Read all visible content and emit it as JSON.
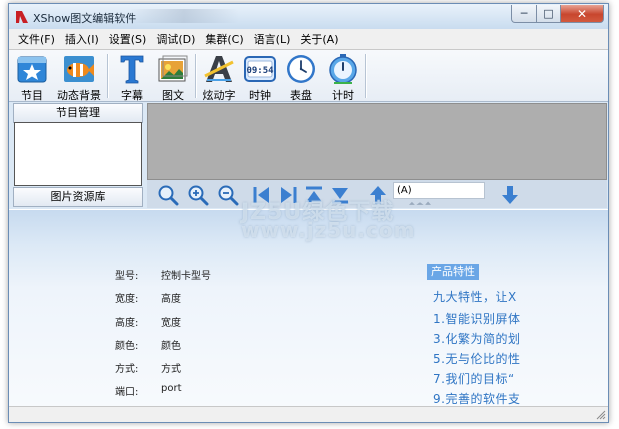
{
  "window": {
    "title": "XShow图文编辑软件",
    "buttons": {
      "minimize": "─",
      "maximize": "□",
      "close": "✕"
    }
  },
  "menu": [
    {
      "label": "文件(F)"
    },
    {
      "label": "插入(I)"
    },
    {
      "label": "设置(S)"
    },
    {
      "label": "调试(D)"
    },
    {
      "label": "集群(C)"
    },
    {
      "label": "语言(L)"
    },
    {
      "label": "关于(A)"
    }
  ],
  "toolbar": [
    {
      "label": "节目",
      "icon": "program-star-icon"
    },
    {
      "label": "动态背景",
      "icon": "clownfish-background-icon"
    },
    {
      "label": "字幕",
      "icon": "text-t-icon"
    },
    {
      "label": "图文",
      "icon": "picture-text-icon"
    },
    {
      "label": "炫动字",
      "icon": "dazzle-text-icon"
    },
    {
      "label": "时钟",
      "icon": "digital-clock-icon",
      "clock_display": "09:54"
    },
    {
      "label": "表盘",
      "icon": "analog-clock-icon"
    },
    {
      "label": "计时",
      "icon": "timer-icon"
    }
  ],
  "left_panel": {
    "program_header": "节目管理",
    "resource_header": "图片资源库"
  },
  "iconbar": {
    "text_field_value": "(A)"
  },
  "properties": [
    {
      "label": "型号:",
      "value": "控制卡型号"
    },
    {
      "label": "宽度:",
      "value": "高度"
    },
    {
      "label": "高度:",
      "value": "宽度"
    },
    {
      "label": "颜色:",
      "value": "颜色"
    },
    {
      "label": "方式:",
      "value": "方式"
    },
    {
      "label": "端口:",
      "value": "port"
    }
  ],
  "features": {
    "title": "产品特性",
    "lines": [
      "九大特性，让X",
      "1.智能识别屏体",
      "3.化繁为简的划",
      "5.无与伦比的性",
      "7.我们的目标“",
      "9.完善的软件支"
    ]
  },
  "watermark": {
    "line1": "JZ5U绿色下载",
    "line2": "www.jz5u.com"
  },
  "colors": {
    "accent": "#2f75c4",
    "feature_tag": "#6aa6e6",
    "preview_gray": "#aeaeae"
  }
}
